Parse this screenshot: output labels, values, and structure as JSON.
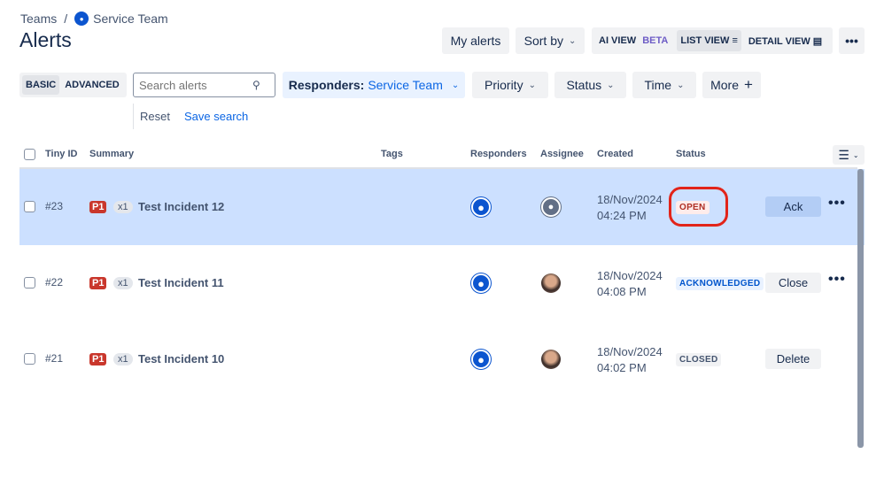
{
  "breadcrumb": {
    "root": "Teams",
    "separator": "/",
    "team": "Service Team"
  },
  "page_title": "Alerts",
  "toolbar": {
    "my_alerts": "My alerts",
    "sort_by": "Sort by",
    "ai_view": "AI VIEW",
    "beta": "BETA",
    "list_view": "LIST VIEW",
    "detail_view": "DETAIL VIEW",
    "more": "•••"
  },
  "filters": {
    "basic": "BASIC",
    "advanced": "ADVANCED",
    "search_placeholder": "Search alerts",
    "responders_label": "Responders:",
    "responders_value": "Service Team",
    "priority": "Priority",
    "status": "Status",
    "time": "Time",
    "more": "More",
    "reset": "Reset",
    "save_search": "Save search"
  },
  "table": {
    "headers": {
      "tiny_id": "Tiny ID",
      "summary": "Summary",
      "tags": "Tags",
      "responders": "Responders",
      "assignee": "Assignee",
      "created": "Created",
      "status": "Status"
    },
    "rows": [
      {
        "id": "#23",
        "priority": "P1",
        "count": "x1",
        "title": "Test Incident 12",
        "date": "18/Nov/2024",
        "time": "04:24 PM",
        "status": "OPEN",
        "action": "Ack",
        "selected": true
      },
      {
        "id": "#22",
        "priority": "P1",
        "count": "x1",
        "title": "Test Incident 11",
        "date": "18/Nov/2024",
        "time": "04:08 PM",
        "status": "ACKNOWLEDGED",
        "action": "Close",
        "selected": false
      },
      {
        "id": "#21",
        "priority": "P1",
        "count": "x1",
        "title": "Test Incident 10",
        "date": "18/Nov/2024",
        "time": "04:02 PM",
        "status": "CLOSED",
        "action": "Delete",
        "selected": false
      }
    ]
  },
  "colors": {
    "accent": "#0c66e4",
    "selected_row": "#cce0ff",
    "open": "#ae2e24",
    "acknowledged": "#0055cc",
    "closed": "#44546f",
    "highlight": "#e2241a"
  }
}
